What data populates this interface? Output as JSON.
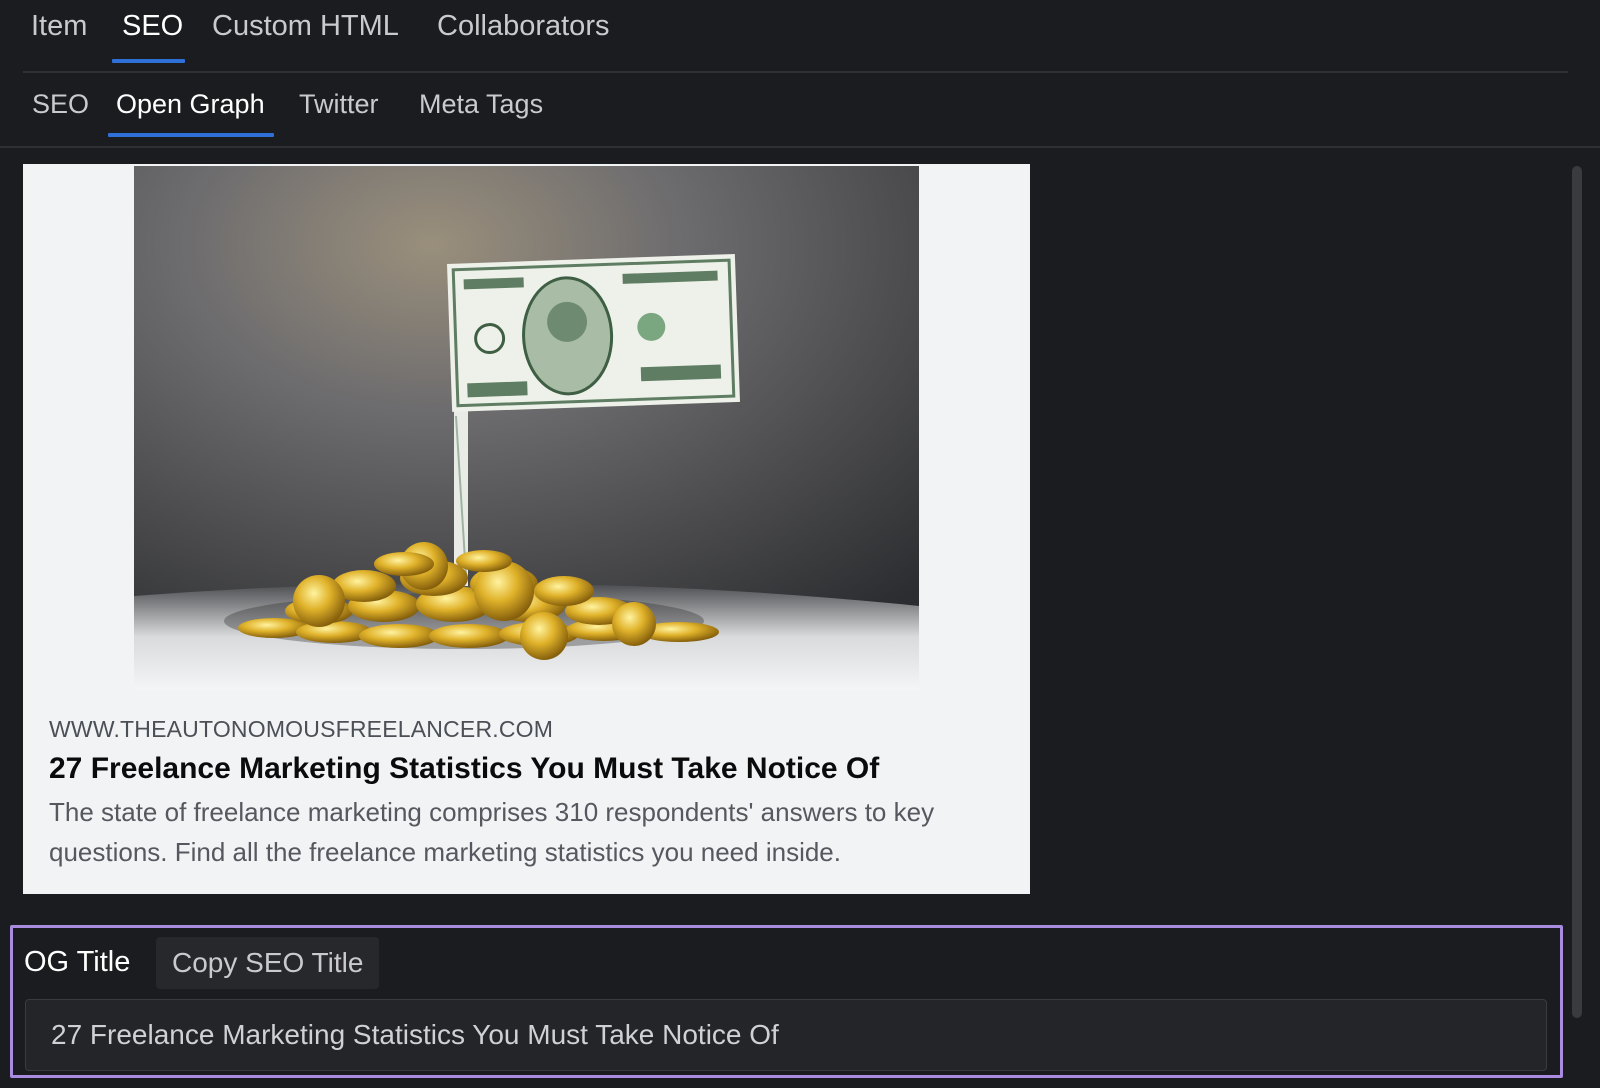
{
  "top_tabs": [
    {
      "label": "Item",
      "active": false
    },
    {
      "label": "SEO",
      "active": true
    },
    {
      "label": "Custom HTML",
      "active": false
    },
    {
      "label": "Collaborators",
      "active": false
    }
  ],
  "sub_tabs": [
    {
      "label": "SEO",
      "active": false
    },
    {
      "label": "Open Graph",
      "active": true
    },
    {
      "label": "Twitter",
      "active": false
    },
    {
      "label": "Meta Tags",
      "active": false
    }
  ],
  "preview": {
    "image_description_icon": "dollar-flag-coins-photo",
    "domain": "WWW.THEAUTONOMOUSFREELANCER.COM",
    "title": "27 Freelance Marketing Statistics You Must Take Notice Of",
    "description": "The state of freelance marketing comprises 310 respondents' answers to key questions. Find all the freelance marketing statistics you need inside."
  },
  "og_title_field": {
    "label": "OG Title",
    "copy_button_label": "Copy SEO Title",
    "value": "27 Freelance Marketing Statistics You Must Take Notice Of"
  },
  "colors": {
    "background": "#1b1c1f",
    "accent": "#2e6fd8",
    "focus_border": "#a98be0",
    "card_background": "#f2f3f5"
  }
}
